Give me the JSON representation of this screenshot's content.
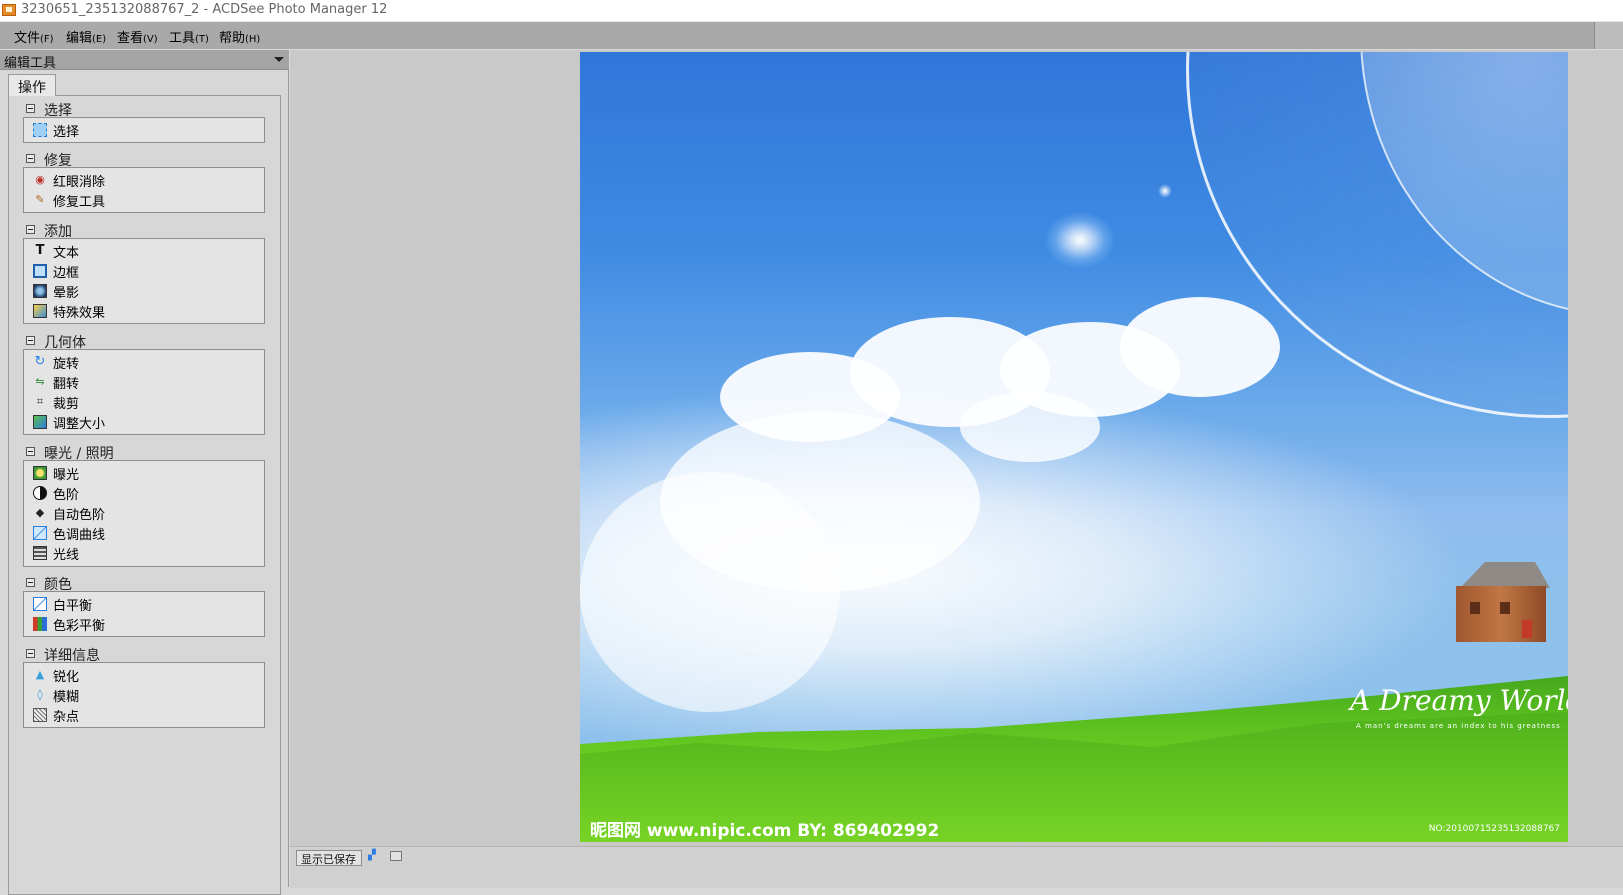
{
  "window": {
    "title": "3230651_235132088767_2 - ACDSee Photo Manager 12"
  },
  "menu": [
    {
      "label": "文件",
      "accel": "(F)"
    },
    {
      "label": "编辑",
      "accel": "(E)"
    },
    {
      "label": "查看",
      "accel": "(V)"
    },
    {
      "label": "工具",
      "accel": "(T)"
    },
    {
      "label": "帮助",
      "accel": "(H)"
    }
  ],
  "panel": {
    "title": "编辑工具",
    "tab": "操作",
    "sections": [
      {
        "title": "选择",
        "items": [
          {
            "label": "选择",
            "icon": "select-icon"
          }
        ]
      },
      {
        "title": "修复",
        "items": [
          {
            "label": "红眼消除",
            "icon": "red-eye-icon"
          },
          {
            "label": "修复工具",
            "icon": "repair-tool-icon"
          }
        ]
      },
      {
        "title": "添加",
        "items": [
          {
            "label": "文本",
            "icon": "text-icon"
          },
          {
            "label": "边框",
            "icon": "border-icon"
          },
          {
            "label": "晕影",
            "icon": "vignette-icon"
          },
          {
            "label": "特殊效果",
            "icon": "special-effects-icon"
          }
        ]
      },
      {
        "title": "几何体",
        "items": [
          {
            "label": "旋转",
            "icon": "rotate-icon"
          },
          {
            "label": "翻转",
            "icon": "flip-icon"
          },
          {
            "label": "裁剪",
            "icon": "crop-icon"
          },
          {
            "label": "调整大小",
            "icon": "resize-icon"
          }
        ]
      },
      {
        "title": "曝光 / 照明",
        "items": [
          {
            "label": "曝光",
            "icon": "exposure-icon"
          },
          {
            "label": "色阶",
            "icon": "levels-icon"
          },
          {
            "label": "自动色阶",
            "icon": "auto-levels-icon"
          },
          {
            "label": "色调曲线",
            "icon": "tone-curve-icon"
          },
          {
            "label": "光线",
            "icon": "lighting-icon"
          }
        ]
      },
      {
        "title": "颜色",
        "items": [
          {
            "label": "白平衡",
            "icon": "white-balance-icon"
          },
          {
            "label": "色彩平衡",
            "icon": "color-balance-icon"
          }
        ]
      },
      {
        "title": "详细信息",
        "items": [
          {
            "label": "锐化",
            "icon": "sharpen-icon"
          },
          {
            "label": "模糊",
            "icon": "blur-icon"
          },
          {
            "label": "杂点",
            "icon": "noise-icon"
          }
        ]
      }
    ]
  },
  "image": {
    "title_text": "A Dreamy World",
    "subtitle_text": "A man's dreams are an index to his greatness",
    "watermark": "昵图网 www.nipic.com  BY: 869402992",
    "number": "NO:20100715235132088767"
  },
  "bottom": {
    "button_label": "显示已保存"
  },
  "colors": {
    "menubar": "#a9a9a9",
    "panel_bg": "#d7d7d7",
    "work_bg": "#c9c9c9"
  }
}
